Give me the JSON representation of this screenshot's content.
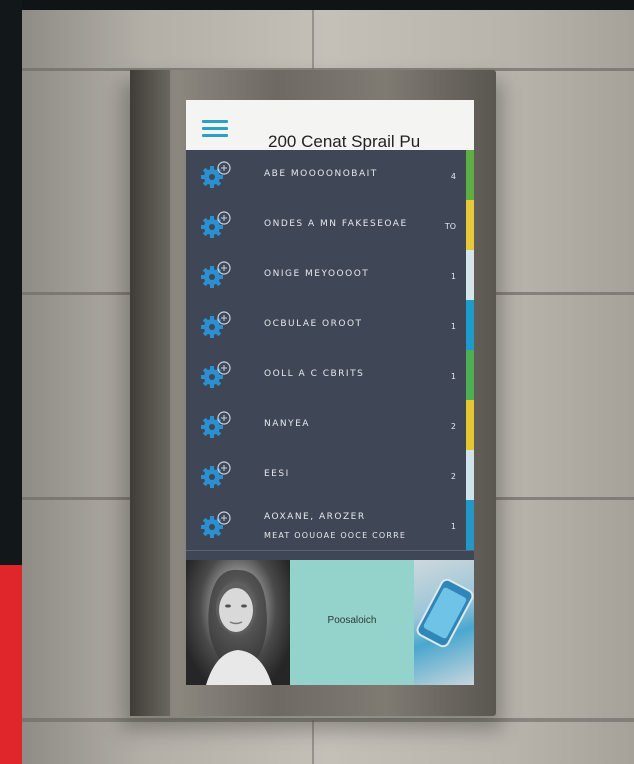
{
  "screen": {
    "header": {
      "title": "200 Cenat Sprail Pu",
      "menu_icon": "hamburger-menu-icon"
    },
    "list": [
      {
        "label": "ABE MOOOONOBAIT",
        "sublabel": "",
        "count": "4",
        "stripe_color": "#5fae43"
      },
      {
        "label": "ONDES A MN FAKESEOAE",
        "sublabel": "",
        "count": "TO",
        "stripe_color": "#e7c83a"
      },
      {
        "label": "ONIGE MEYOOOOT",
        "sublabel": "",
        "count": "1",
        "stripe_color": "#d6e5ea"
      },
      {
        "label": "OCBULAE OROOT",
        "sublabel": "",
        "count": "1",
        "stripe_color": "#1e9bc8"
      },
      {
        "label": "OOLL A C CBRITS",
        "sublabel": "",
        "count": "1",
        "stripe_color": "#4fae53"
      },
      {
        "label": "NANYEA",
        "sublabel": "",
        "count": "2",
        "stripe_color": "#e5c734"
      },
      {
        "label": "EESI",
        "sublabel": "",
        "count": "2",
        "stripe_color": "#cfe3ea"
      },
      {
        "label": "AOXANE, AROZER",
        "sublabel": "MEAT OOUOAE OOCE CORRE",
        "count": "1",
        "stripe_color": "#2398c6"
      }
    ],
    "row_icon": "blue-gear-icon",
    "promo": {
      "teal_text": "Poosaloich",
      "teal_color": "#93d3cb"
    }
  },
  "colors": {
    "list_bg": "#3f4756",
    "accent_red": "#e1262b",
    "header_bg": "#f4f4f2"
  }
}
